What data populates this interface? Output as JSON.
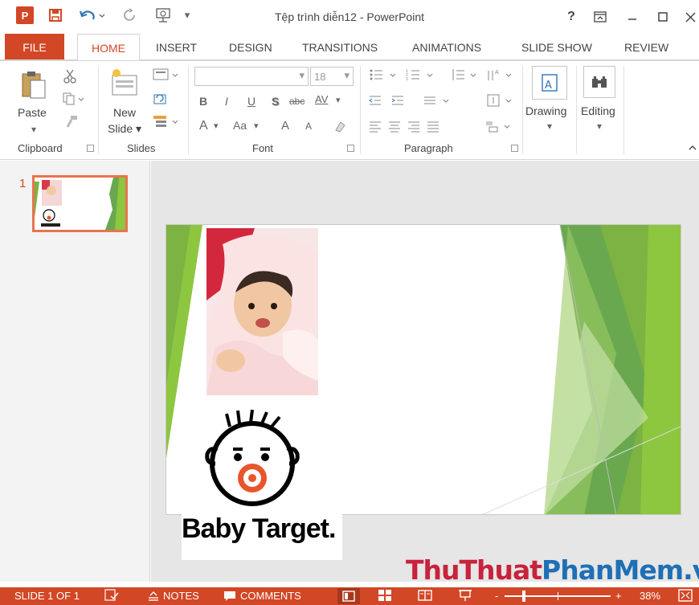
{
  "window": {
    "title": "Tệp trình diễn12 - PowerPoint",
    "app_logo": "P",
    "help": "?"
  },
  "tabs": [
    "FILE",
    "HOME",
    "INSERT",
    "DESIGN",
    "TRANSITIONS",
    "ANIMATIONS",
    "SLIDE SHOW",
    "REVIEW"
  ],
  "ribbon": {
    "clipboard": {
      "paste": "Paste",
      "group": "Clipboard"
    },
    "slides": {
      "new_line1": "New",
      "new_line2": "Slide",
      "group": "Slides"
    },
    "font": {
      "size": "18",
      "bold": "B",
      "italic": "I",
      "underline": "U",
      "shadow": "S",
      "strike": "abc",
      "spacing": "AV",
      "color": "A",
      "case": "Aa",
      "grow": "A",
      "shrink": "A",
      "group": "Font"
    },
    "paragraph": {
      "group": "Paragraph"
    },
    "drawing": {
      "label": "Drawing"
    },
    "editing": {
      "label": "Editing"
    }
  },
  "thumbnails": [
    {
      "number": "1"
    }
  ],
  "slide": {
    "logo_text": "Baby Target."
  },
  "watermark": {
    "part1": "ThuThuat",
    "part2": "PhanMem.vn"
  },
  "status": {
    "slide": "SLIDE 1 OF 1",
    "notes": "NOTES",
    "comments": "COMMENTS",
    "zoom": "38%",
    "zoom_minus": "-",
    "zoom_plus": "+",
    "zoom_level": 0.38
  },
  "colors": {
    "accent": "#d24726",
    "green_dark": "#6aa84f",
    "green_light": "#8dc63f"
  }
}
